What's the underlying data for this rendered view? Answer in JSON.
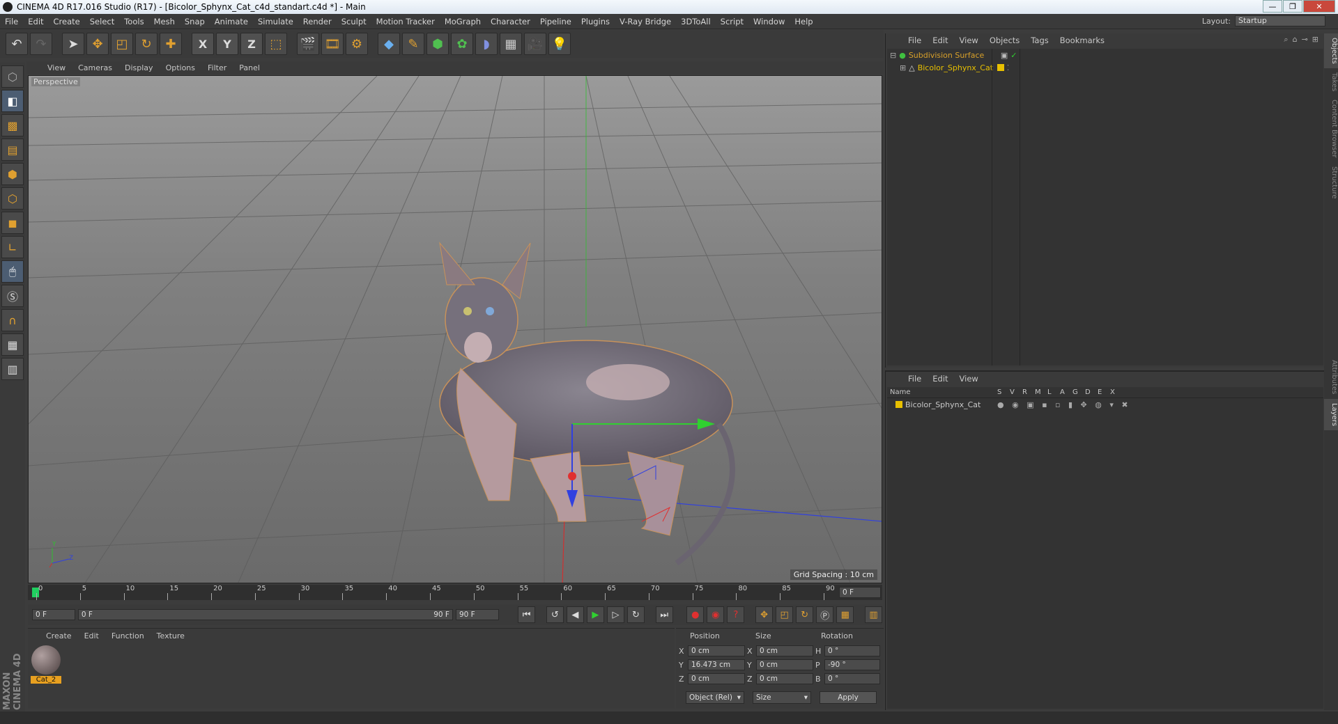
{
  "window": {
    "title": "CINEMA 4D R17.016 Studio (R17) - [Bicolor_Sphynx_Cat_c4d_standart.c4d *] - Main",
    "controls": [
      "—",
      "❐",
      "✕"
    ]
  },
  "menubar": [
    "File",
    "Edit",
    "Create",
    "Select",
    "Tools",
    "Mesh",
    "Snap",
    "Animate",
    "Simulate",
    "Render",
    "Sculpt",
    "Motion Tracker",
    "MoGraph",
    "Character",
    "Pipeline",
    "Plugins",
    "V-Ray Bridge",
    "3DToAll",
    "Script",
    "Window",
    "Help"
  ],
  "layout": {
    "label": "Layout:",
    "value": "Startup"
  },
  "toolbar": {
    "axis_x": "X",
    "axis_y": "Y",
    "axis_z": "Z"
  },
  "viewport": {
    "menu": [
      "View",
      "Cameras",
      "Display",
      "Options",
      "Filter",
      "Panel"
    ],
    "label": "Perspective",
    "grid_spacing": "Grid Spacing : 10 cm",
    "axis_y": "Y",
    "axis_z": "Z"
  },
  "timeline": {
    "ticks": [
      "0",
      "5",
      "10",
      "15",
      "20",
      "25",
      "30",
      "35",
      "40",
      "45",
      "50",
      "55",
      "60",
      "65",
      "70",
      "75",
      "80",
      "85",
      "90"
    ],
    "current_frame": "0 F",
    "start_field": "0 F",
    "range_start": "0 F",
    "range_end": "90 F",
    "end_field": "90 F"
  },
  "materials": {
    "menu": [
      "Create",
      "Edit",
      "Function",
      "Texture"
    ],
    "items": [
      {
        "name": "Cat_2"
      }
    ]
  },
  "coordinates": {
    "headers": [
      "Position",
      "Size",
      "Rotation"
    ],
    "rows": [
      {
        "axis": "X",
        "pos": "0 cm",
        "size_axis": "X",
        "size": "0 cm",
        "rot_axis": "H",
        "rot": "0 °"
      },
      {
        "axis": "Y",
        "pos": "16.473 cm",
        "size_axis": "Y",
        "size": "0 cm",
        "rot_axis": "P",
        "rot": "-90 °"
      },
      {
        "axis": "Z",
        "pos": "0 cm",
        "size_axis": "Z",
        "size": "0 cm",
        "rot_axis": "B",
        "rot": "0 °"
      }
    ],
    "mode": "Object (Rel)",
    "size_mode": "Size",
    "apply": "Apply"
  },
  "objects": {
    "menu": [
      "File",
      "Edit",
      "View",
      "Objects",
      "Tags",
      "Bookmarks"
    ],
    "items": [
      {
        "name": "Subdivision Surface",
        "color": "#d8a02a"
      },
      {
        "name": "Bicolor_Sphynx_Cat",
        "color": "#e8c000"
      }
    ]
  },
  "layers": {
    "menu": [
      "File",
      "Edit",
      "View"
    ],
    "columns": [
      "Name",
      "S",
      "V",
      "R",
      "M",
      "L",
      "A",
      "G",
      "D",
      "E",
      "X"
    ],
    "items": [
      {
        "name": "Bicolor_Sphynx_Cat"
      }
    ]
  },
  "side_tabs": [
    "Objects",
    "Takes",
    "Content Browser",
    "Structure",
    "Attributes",
    "Layers"
  ],
  "branding": "MAXON CINEMA 4D",
  "colors": {
    "accent": "#e0a030",
    "panel": "#3a3a3a",
    "x_axis": "#d03030",
    "y_axis": "#30c030",
    "z_axis": "#3040e0"
  }
}
